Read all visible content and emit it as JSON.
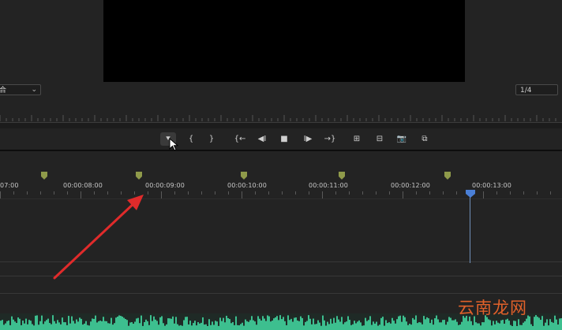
{
  "monitor": {
    "fit_dropdown": {
      "value": "合"
    },
    "resolution_dropdown": {
      "value": "1/4"
    },
    "controls": [
      {
        "name": "add-marker-button",
        "glyph": "⯆",
        "active": true
      },
      {
        "name": "mark-in-button",
        "glyph": "{"
      },
      {
        "name": "mark-out-button",
        "glyph": "}"
      },
      {
        "name": "go-to-in-button",
        "glyph": "{←"
      },
      {
        "name": "step-back-button",
        "glyph": "◀I"
      },
      {
        "name": "stop-button",
        "glyph": "■"
      },
      {
        "name": "step-forward-button",
        "glyph": "I▶"
      },
      {
        "name": "go-to-out-button",
        "glyph": "→}"
      },
      {
        "name": "lift-button",
        "glyph": "⊞"
      },
      {
        "name": "extract-button",
        "glyph": "⊟"
      },
      {
        "name": "export-frame-button",
        "glyph": "📷"
      },
      {
        "name": "comparison-view-button",
        "glyph": "⧉"
      }
    ]
  },
  "timeline": {
    "timecodes": [
      "07:00",
      "00:00:08:00",
      "00:00:09:00",
      "00:00:10:00",
      "00:00:11:00",
      "00:00:12:00",
      "00:00:13:00"
    ],
    "marker_color": "#8f9a4a",
    "playhead_color": "#4a7fd6"
  },
  "watermark": {
    "text": "云南龙网"
  },
  "colors": {
    "background": "#232323",
    "arrow": "#e02b2b",
    "waveform": "#3dbf8f"
  }
}
